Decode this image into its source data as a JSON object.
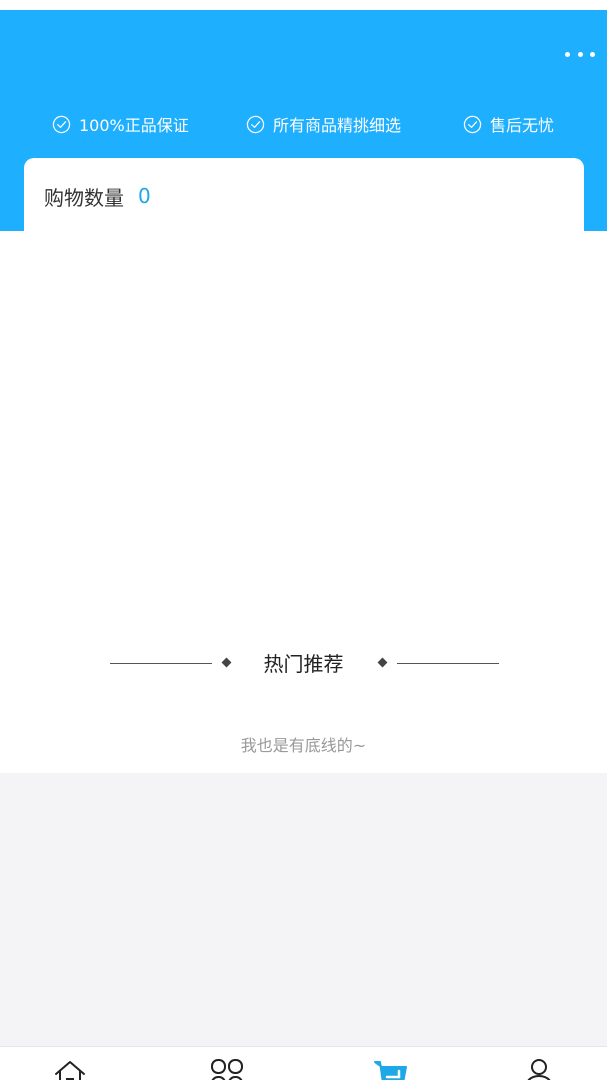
{
  "header": {
    "background_color": "#1eafff",
    "more_icon": "more-dots-icon",
    "guarantees": [
      {
        "icon": "check-circle-icon",
        "label": "100%正品保证"
      },
      {
        "icon": "check-circle-icon",
        "label": "所有商品精挑细选"
      },
      {
        "icon": "check-circle-icon",
        "label": "售后无忧"
      }
    ]
  },
  "cart": {
    "count_label": "购物数量",
    "count_value": "0",
    "accent_color": "#1ea8e8"
  },
  "recommendations": {
    "title": "热门推荐",
    "end_text": "我也是有底线的~"
  },
  "tabbar": {
    "active_color": "#1ea8e8",
    "items": [
      {
        "icon": "home-icon",
        "active": false
      },
      {
        "icon": "category-icon",
        "active": false
      },
      {
        "icon": "cart-icon",
        "active": true
      },
      {
        "icon": "user-icon",
        "active": false
      }
    ]
  }
}
